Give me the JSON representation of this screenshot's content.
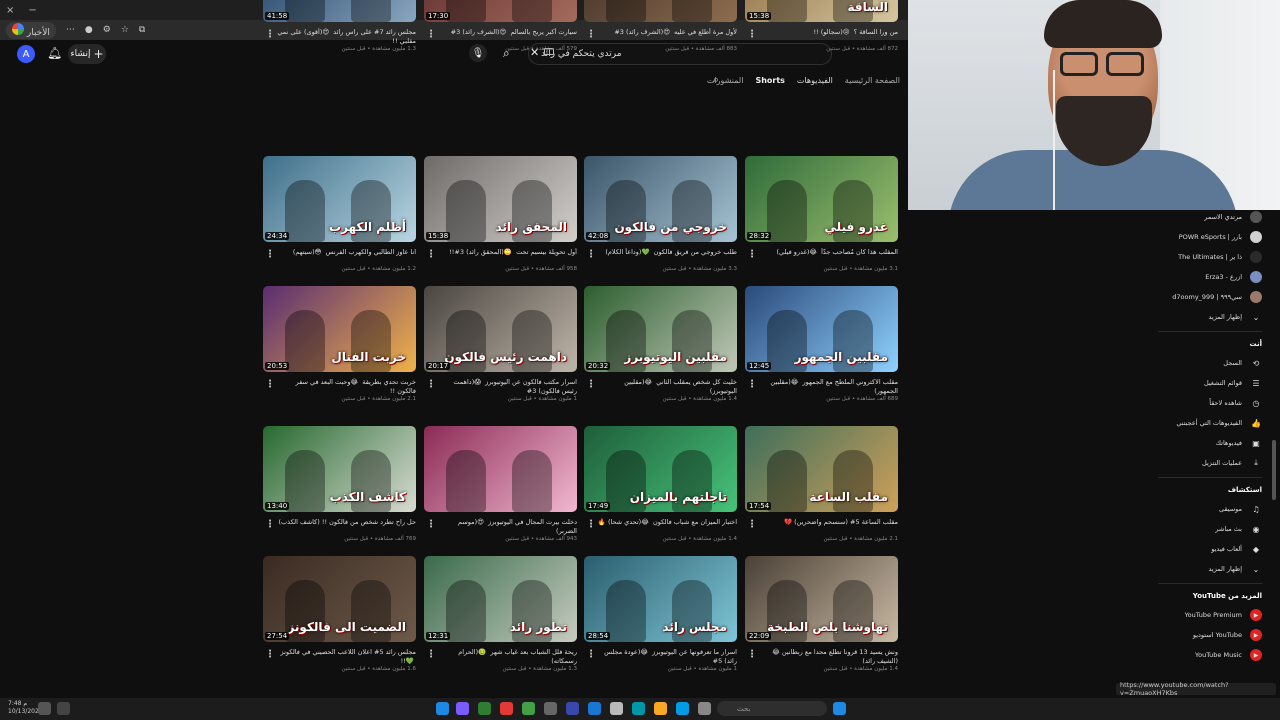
{
  "browser": {
    "tab_label": "الأخبار",
    "window_controls": [
      "×",
      "−"
    ]
  },
  "header": {
    "avatar_letter": "A",
    "create_label": "إنشاء",
    "search_value": "مرتدي يتحكم في رائد",
    "tabs": [
      "الصفحة الرئيسية",
      "الفيديوهات",
      "Shorts",
      "المنشورات"
    ],
    "active_tab": "Shorts"
  },
  "videos": [
    {
      "title": "من ورا الساقة ؟ ‎😢 ‎(سجالو) !!",
      "meta": "872 ألف مشاهدة • قبل سنتين",
      "duration": "15:38",
      "stamp": "الساقة",
      "c1": "#8c6a3e",
      "c2": "#d6c7a1"
    },
    {
      "title": "لأول مرة أطلع في عليه ‎😍 ‎(الشرف رائد) 3#",
      "meta": "883 ألف مشاهدة • قبل سنتين",
      "duration": "",
      "stamp": "",
      "c1": "#3b2d25",
      "c2": "#8e6d50"
    },
    {
      "title": "سيارت أكبر يربح بالسالم ‎😍 ‎(الشرف رائد) 3#",
      "meta": "579 ألف مشاهدة • قبل سنتين",
      "duration": "17:30",
      "stamp": "",
      "c1": "#5a2a2a",
      "c2": "#a36b5d"
    },
    {
      "title": "مجلس رائد 7# على راس رائد ‎😍 ‎(أقوى) على نمي مقلبي !!",
      "meta": "1.3 مليون مشاهدة • قبل سنتين",
      "duration": "41:58",
      "stamp": "",
      "c1": "#1b3a5e",
      "c2": "#8aa7c0"
    },
    {
      "title": "المقلب هذا كان مُصاحب جدّاً ‎😂 ‎(غدرو فيلي)",
      "meta": "3.1 مليون مشاهدة • قبل سنتين",
      "duration": "28:32",
      "stamp": "غدرو فيلي",
      "c1": "#2f6b3a",
      "c2": "#9bbf6e"
    },
    {
      "title": "طلب خروجي من فريق فالكون ‎💚 ‎(وداعاً الكلام)",
      "meta": "3.3 مليون مشاهدة • قبل سنتين",
      "duration": "42:08",
      "stamp": "خروجي من فالكون",
      "c1": "#3a5568",
      "c2": "#a7c4d4"
    },
    {
      "title": "أول تحويلة بيسيم تحت ‎🙄 ‎(المحقق رائد) 3#!!",
      "meta": "958 ألف مشاهدة • قبل سنتين",
      "duration": "15:38",
      "stamp": "المحقق رائد",
      "c1": "#6e6a68",
      "c2": "#d3d0cc"
    },
    {
      "title": "انا عاوز الطالبي والكهرب الفرنس ‎😳 ‎(سيتهم)",
      "meta": "1.2 مليون مشاهدة • قبل سنتين",
      "duration": "24:34",
      "stamp": "أظلم الكهرب",
      "c1": "#3f6f8a",
      "c2": "#b9d6e2"
    },
    {
      "title": "مقلب الاكتروني الملطج مع الجمهور ‎😂 ‎(مقلبين الجمهور)",
      "meta": "689 ألف مشاهدة • قبل سنتين",
      "duration": "12:45",
      "stamp": "مقلبين الجمهور",
      "c1": "#2a4a7a",
      "c2": "#8fd1ff"
    },
    {
      "title": "خليت كل شخص يمقلب الثاني ‎😂 ‎(مقلبين اليوتيوبرز)",
      "meta": "1.4 مليون مشاهدة • قبل سنتين",
      "duration": "20:32",
      "stamp": "مقلبين اليوتيوبرز",
      "c1": "#2c5e2e",
      "c2": "#c0c8b8"
    },
    {
      "title": "اسرار مكتب فالكون عن اليوتيوبرز ‎😱 ‎(داهمت رئيس فالكون) 3#",
      "meta": "1 مليون مشاهدة • قبل سنتين",
      "duration": "20:17",
      "stamp": "داهمت رئيس فالكون",
      "c1": "#4a4540",
      "c2": "#bfb6aa"
    },
    {
      "title": "خربت تحدي بطريقة ‎😂 ‎وحبت البعد في سفر فالكون !!",
      "meta": "2.1 مليون مشاهدة • قبل سنتين",
      "duration": "20:53",
      "stamp": "خربت الفنال",
      "c1": "#5a2d72",
      "c2": "#f0b24a"
    },
    {
      "title": "مقلب الساعة 5# ‎(سنسحم واضحرين) ‎💔",
      "meta": "2.1 مليون مشاهدة • قبل سنتين",
      "duration": "17:54",
      "stamp": "مقلب الساعة",
      "c1": "#3e6e5a",
      "c2": "#cfa15a"
    },
    {
      "title": "اختبار الميزان مع شباب فالكون ‎😂 ‎(تحدي شحا) ‎🔥",
      "meta": "1.4 مليون مشاهدة • قبل سنتين",
      "duration": "17:49",
      "stamp": "تاجلتهم بالميزان",
      "c1": "#1e5e3a",
      "c2": "#47c37a"
    },
    {
      "title": "دخلت بيرت المجال في اليوتيوبرز ‎😍 ‎(موسم الضربر)",
      "meta": "943 ألف مشاهدة • قبل سنتين",
      "duration": "",
      "stamp": "",
      "c1": "#8a2a55",
      "c2": "#f2b8d0"
    },
    {
      "title": "حل راح تطرد شخص من فالكون !! (كاشف الكذب)",
      "meta": "769 ألف مشاهدة • قبل سنتين",
      "duration": "13:40",
      "stamp": "كاشف الكذب",
      "c1": "#27692f",
      "c2": "#d9dcd3"
    },
    {
      "title": "ونش يسيد 13 قرونا تطلع محدا مع ربطانين ‎😂 ‎(الشيف رائد)",
      "meta": "1.4 مليون مشاهدة • قبل سنتين",
      "duration": "22:09",
      "stamp": "تهاوشنا بلص الطبخة",
      "c1": "#4a4036",
      "c2": "#c9b9a3"
    },
    {
      "title": "اسرار ما تعرفونها عن اليوتيوبرز ‎😂 ‎(عودة مجلس رائد) 5#",
      "meta": "1 مليون مشاهدة • قبل سنتين",
      "duration": "28:54",
      "stamp": "مجلس رائد",
      "c1": "#2a5e6e",
      "c2": "#7fc6d6"
    },
    {
      "title": "ريحة فلل الشباب بعد غياب شهر ‎🤢 ‎(الحرام رسمكاته)",
      "meta": "1.3 مليون مشاهدة • قبل سنتين",
      "duration": "12:31",
      "stamp": "تطور رائد",
      "c1": "#3a6a4a",
      "c2": "#c6ccc1"
    },
    {
      "title": "مجلس رائد 5# اعلان اللاعب الحصيني في فالكونز ‎💚 ‎!!",
      "meta": "1.6 مليون مشاهدة • قبل سنتين",
      "duration": "27:54",
      "stamp": "الضميت الى فالكونز",
      "c1": "#3a2b22",
      "c2": "#6e5a4a"
    }
  ],
  "sidebar": {
    "subscriptions": [
      {
        "label": "مرتدي الاسمر",
        "color": "#555"
      },
      {
        "label": "POWR eSports | بارر",
        "color": "#d0d0d0"
      },
      {
        "label": "The Ultimates | ذا ير",
        "color": "#2b2b2b"
      },
      {
        "label": "Erza3 - ازرع",
        "color": "#7a8ec0"
      },
      {
        "label": "d7oomy_999 | سي٩٩٩",
        "color": "#9a7a6a"
      }
    ],
    "show_more": "إظهار المزيد",
    "you_heading": "أنت",
    "you_items": [
      {
        "label": "السجل",
        "icon": "⟲"
      },
      {
        "label": "قوائم التشغيل",
        "icon": "☰"
      },
      {
        "label": "شاهده لاحقاً",
        "icon": "◷"
      },
      {
        "label": "الفيديوهات التي أعجبتني",
        "icon": "👍"
      },
      {
        "label": "فيديوهاتك",
        "icon": "▣"
      },
      {
        "label": "عمليات التنزيل",
        "icon": "⤓"
      }
    ],
    "explore_heading": "استكشاف",
    "explore_items": [
      {
        "label": "موسيقى",
        "icon": "♫"
      },
      {
        "label": "بث مباشر",
        "icon": "◉"
      },
      {
        "label": "ألعاب فيديو",
        "icon": "◆"
      },
      {
        "label": "إظهار المزيد",
        "icon": "⌄"
      }
    ],
    "more_heading": "المزيد من YouTube",
    "more_items": [
      {
        "label": "YouTube Premium"
      },
      {
        "label": "استوديو YouTube"
      },
      {
        "label": "YouTube Music"
      }
    ]
  },
  "status_url": "https://www.youtube.com/watch?v=ZmuaoXH7Kbs",
  "taskbar": {
    "search_placeholder": "بحث",
    "time": "7:48 م",
    "date": "10/13/2024"
  }
}
